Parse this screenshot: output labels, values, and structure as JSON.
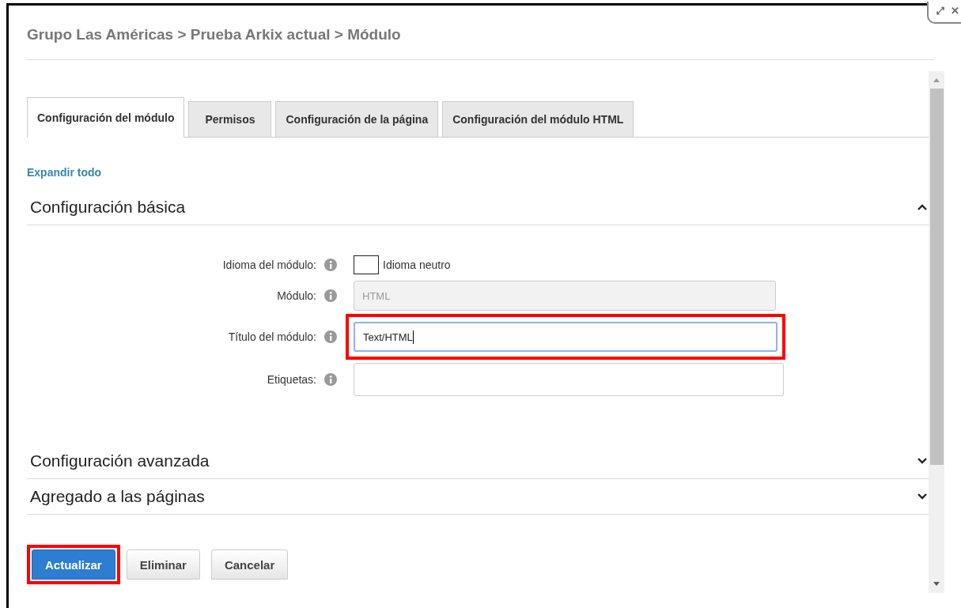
{
  "window_controls": {
    "restore": "⤢",
    "close": "✕"
  },
  "breadcrumb": "Grupo Las Américas > Prueba Arkix actual > Módulo",
  "tabs": [
    {
      "label": "Configuración del módulo",
      "selected": true
    },
    {
      "label": "Permisos",
      "selected": false
    },
    {
      "label": "Configuración de la página",
      "selected": false
    },
    {
      "label": "Configuración del módulo HTML",
      "selected": false
    }
  ],
  "expand_all": "Expandir todo",
  "sections": [
    {
      "title": "Configuración básica",
      "expanded": true,
      "fields": [
        {
          "kind": "checkbox",
          "label": "Idioma del módulo:",
          "text": "Idioma neutro",
          "checked": false,
          "highlighted": false
        },
        {
          "kind": "input",
          "label": "Módulo:",
          "value": "HTML",
          "disabled": true,
          "focused": false,
          "highlighted": false
        },
        {
          "kind": "input",
          "label": "Título del módulo:",
          "value": "Text/HTML",
          "disabled": false,
          "focused": true,
          "highlighted": true
        },
        {
          "kind": "input",
          "label": "Etiquetas:",
          "disabled": false,
          "focused": false,
          "highlighted": false
        }
      ]
    },
    {
      "title": "Configuración avanzada",
      "expanded": false
    },
    {
      "title": "Agregado a las páginas",
      "expanded": false
    }
  ],
  "buttons": [
    {
      "label": "Actualizar",
      "kind": "primary",
      "highlighted": true
    },
    {
      "label": "Eliminar",
      "kind": "secondary",
      "highlighted": false
    },
    {
      "label": "Cancelar",
      "kind": "secondary",
      "highlighted": false
    }
  ]
}
